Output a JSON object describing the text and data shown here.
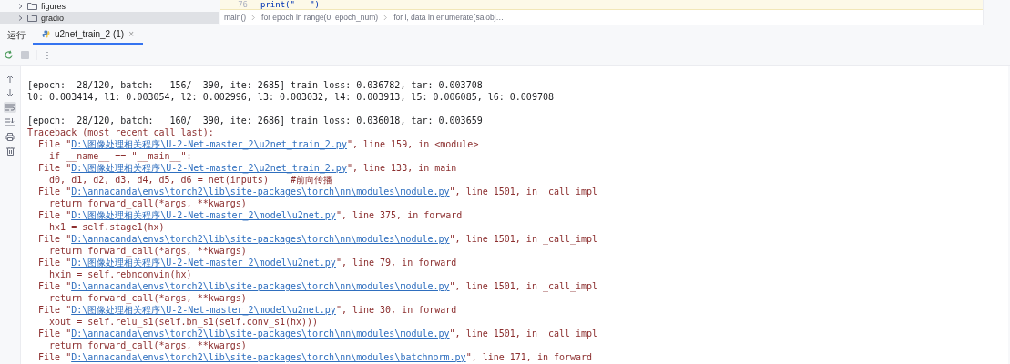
{
  "project_tree": {
    "items": [
      {
        "label": "figures",
        "expanded": false,
        "selected": false
      },
      {
        "label": "gradio",
        "expanded": false,
        "selected": true
      }
    ]
  },
  "editor": {
    "line_number": "76",
    "code": "print(\"---\")",
    "breadcrumbs": [
      "main()",
      "for epoch in range(0, epoch_num)",
      "for i, data in enumerate(salobj…"
    ]
  },
  "run_panel": {
    "title": "运行",
    "more": "⋮",
    "tabs": [
      {
        "label": "u2net_train_2 (1)",
        "selected": true,
        "close": "×"
      }
    ]
  },
  "console": {
    "lines": [
      {
        "kind": "output",
        "text": "[epoch:  28/120, batch:   156/  390, ite: 2685] train loss: 0.036782, tar: 0.003708"
      },
      {
        "kind": "output",
        "text": "l0: 0.003414, l1: 0.003054, l2: 0.002996, l3: 0.003032, l4: 0.003913, l5: 0.006085, l6: 0.009708"
      },
      {
        "kind": "blank"
      },
      {
        "kind": "output",
        "text": "[epoch:  28/120, batch:   160/  390, ite: 2686] train loss: 0.036018, tar: 0.003659"
      },
      {
        "kind": "error",
        "text": "Traceback (most recent call last):"
      },
      {
        "kind": "file",
        "pre": "File \"",
        "link": "D:\\图像处理相关程序\\U-2-Net-master_2\\u2net_train_2.py",
        "post": "\", line 159, in <module>"
      },
      {
        "kind": "code",
        "text": "if __name__ == \"__main__\":"
      },
      {
        "kind": "file",
        "pre": "File \"",
        "link": "D:\\图像处理相关程序\\U-2-Net-master_2\\u2net_train_2.py",
        "post": "\", line 133, in main"
      },
      {
        "kind": "code",
        "text": "d0, d1, d2, d3, d4, d5, d6 = net(inputs)    #前向传播"
      },
      {
        "kind": "file",
        "pre": "File \"",
        "link": "D:\\annacanda\\envs\\torch2\\lib\\site-packages\\torch\\nn\\modules\\module.py",
        "post": "\", line 1501, in _call_impl"
      },
      {
        "kind": "code",
        "text": "return forward_call(*args, **kwargs)"
      },
      {
        "kind": "file",
        "pre": "File \"",
        "link": "D:\\图像处理相关程序\\U-2-Net-master_2\\model\\u2net.py",
        "post": "\", line 375, in forward"
      },
      {
        "kind": "code",
        "text": "hx1 = self.stage1(hx)"
      },
      {
        "kind": "file",
        "pre": "File \"",
        "link": "D:\\annacanda\\envs\\torch2\\lib\\site-packages\\torch\\nn\\modules\\module.py",
        "post": "\", line 1501, in _call_impl"
      },
      {
        "kind": "code",
        "text": "return forward_call(*args, **kwargs)"
      },
      {
        "kind": "file",
        "pre": "File \"",
        "link": "D:\\图像处理相关程序\\U-2-Net-master_2\\model\\u2net.py",
        "post": "\", line 79, in forward"
      },
      {
        "kind": "code",
        "text": "hxin = self.rebnconvin(hx)"
      },
      {
        "kind": "file",
        "pre": "File \"",
        "link": "D:\\annacanda\\envs\\torch2\\lib\\site-packages\\torch\\nn\\modules\\module.py",
        "post": "\", line 1501, in _call_impl"
      },
      {
        "kind": "code",
        "text": "return forward_call(*args, **kwargs)"
      },
      {
        "kind": "file",
        "pre": "File \"",
        "link": "D:\\图像处理相关程序\\U-2-Net-master_2\\model\\u2net.py",
        "post": "\", line 30, in forward"
      },
      {
        "kind": "code",
        "text": "xout = self.relu_s1(self.bn_s1(self.conv_s1(hx)))"
      },
      {
        "kind": "file",
        "pre": "File \"",
        "link": "D:\\annacanda\\envs\\torch2\\lib\\site-packages\\torch\\nn\\modules\\module.py",
        "post": "\", line 1501, in _call_impl"
      },
      {
        "kind": "code",
        "text": "return forward_call(*args, **kwargs)"
      },
      {
        "kind": "file",
        "pre": "File \"",
        "link": "D:\\annacanda\\envs\\torch2\\lib\\site-packages\\torch\\nn\\modules\\batchnorm.py",
        "post": "\", line 171, in forward"
      }
    ]
  }
}
